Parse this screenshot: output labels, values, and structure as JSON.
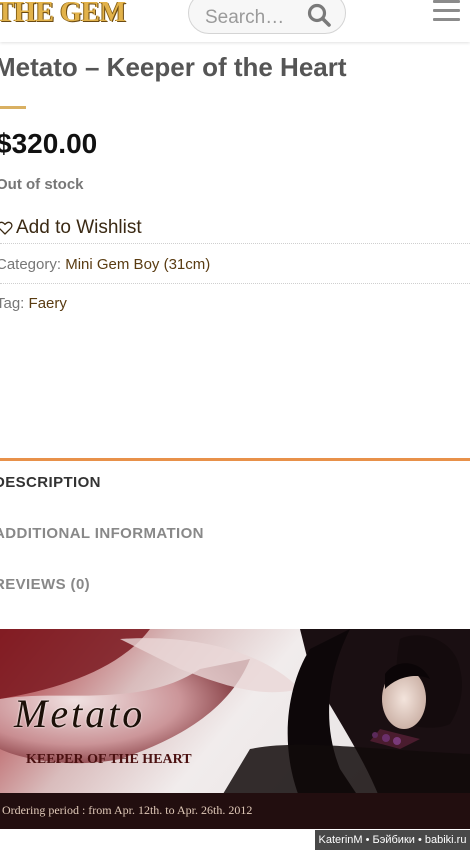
{
  "header": {
    "logo_text": "THE GEM",
    "search_placeholder": "Search…",
    "icons": {
      "search": "search-icon",
      "menu": "hamburger-menu-icon"
    }
  },
  "product": {
    "title": "Metato – Keeper of the Heart",
    "price": "$320.00",
    "stock_status": "Out of stock",
    "wishlist_label": "Add to Wishlist",
    "category_label": "Category:",
    "category_value": "Mini Gem Boy (31cm)",
    "tag_label": "Tag:",
    "tag_value": "Faery"
  },
  "tabs": [
    {
      "label": "DESCRIPTION",
      "active": true
    },
    {
      "label": "ADDITIONAL INFORMATION",
      "active": false
    },
    {
      "label": "REVIEWS (0)",
      "active": false
    }
  ],
  "banner": {
    "name": "Metato",
    "subtitle": "KEEPER OF THE HEART",
    "ordering": "Ordering period : from Apr. 12th. to Apr. 26th. 2012"
  },
  "watermark": "KaterinM • Бэйбики • babiki.ru",
  "colors": {
    "accent_orange": "#e8914a",
    "divider_gold": "#d9b062",
    "link_brown": "#5a3c12",
    "logo_gold": "#e2b24a"
  }
}
